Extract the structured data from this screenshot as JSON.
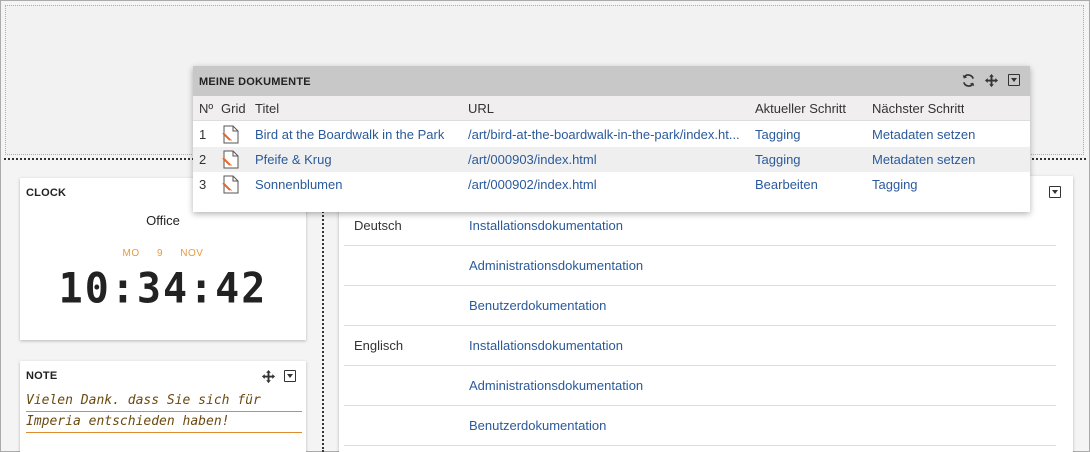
{
  "clock": {
    "title": "CLOCK",
    "place": "Office",
    "day": "MO",
    "date": "9",
    "month": "NOV",
    "time": "10:34:42"
  },
  "note": {
    "title": "NOTE",
    "lines": [
      "Vielen Dank. dass Sie sich für",
      "Imperia entschieden haben!"
    ]
  },
  "documentation": {
    "rows": [
      {
        "lang": "Deutsch",
        "link": "Installationsdokumentation"
      },
      {
        "lang": "",
        "link": "Administrationsdokumentation"
      },
      {
        "lang": "",
        "link": "Benutzerdokumentation"
      },
      {
        "lang": "Englisch",
        "link": "Installationsdokumentation"
      },
      {
        "lang": "",
        "link": "Administrationsdokumentation"
      },
      {
        "lang": "",
        "link": "Benutzerdokumentation"
      }
    ]
  },
  "meine_dokumente": {
    "title": "MEINE DOKUMENTE",
    "columns": {
      "nr": "Nº",
      "grid": "Grid",
      "titel": "Titel",
      "url": "URL",
      "aktuell": "Aktueller Schritt",
      "naechst": "Nächster Schritt"
    },
    "rows": [
      {
        "nr": "1",
        "titel": "Bird at the Boardwalk in the Park",
        "url": "/art/bird-at-the-boardwalk-in-the-park/index.ht...",
        "aktuell": "Tagging",
        "naechst": "Metadaten setzen"
      },
      {
        "nr": "2",
        "titel": "Pfeife & Krug",
        "url": "/art/000903/index.html",
        "aktuell": "Tagging",
        "naechst": "Metadaten setzen"
      },
      {
        "nr": "3",
        "titel": "Sonnenblumen",
        "url": "/art/000902/index.html",
        "aktuell": "Bearbeiten",
        "naechst": "Tagging"
      }
    ]
  },
  "icons": {
    "refresh": "refresh-icon",
    "move": "move-icon",
    "menu": "dropdown-menu-icon",
    "document": "document-edit-icon"
  },
  "colors": {
    "link": "#2b5a9b",
    "accent": "#e89a3c",
    "header_bg": "#c8c8c8"
  }
}
